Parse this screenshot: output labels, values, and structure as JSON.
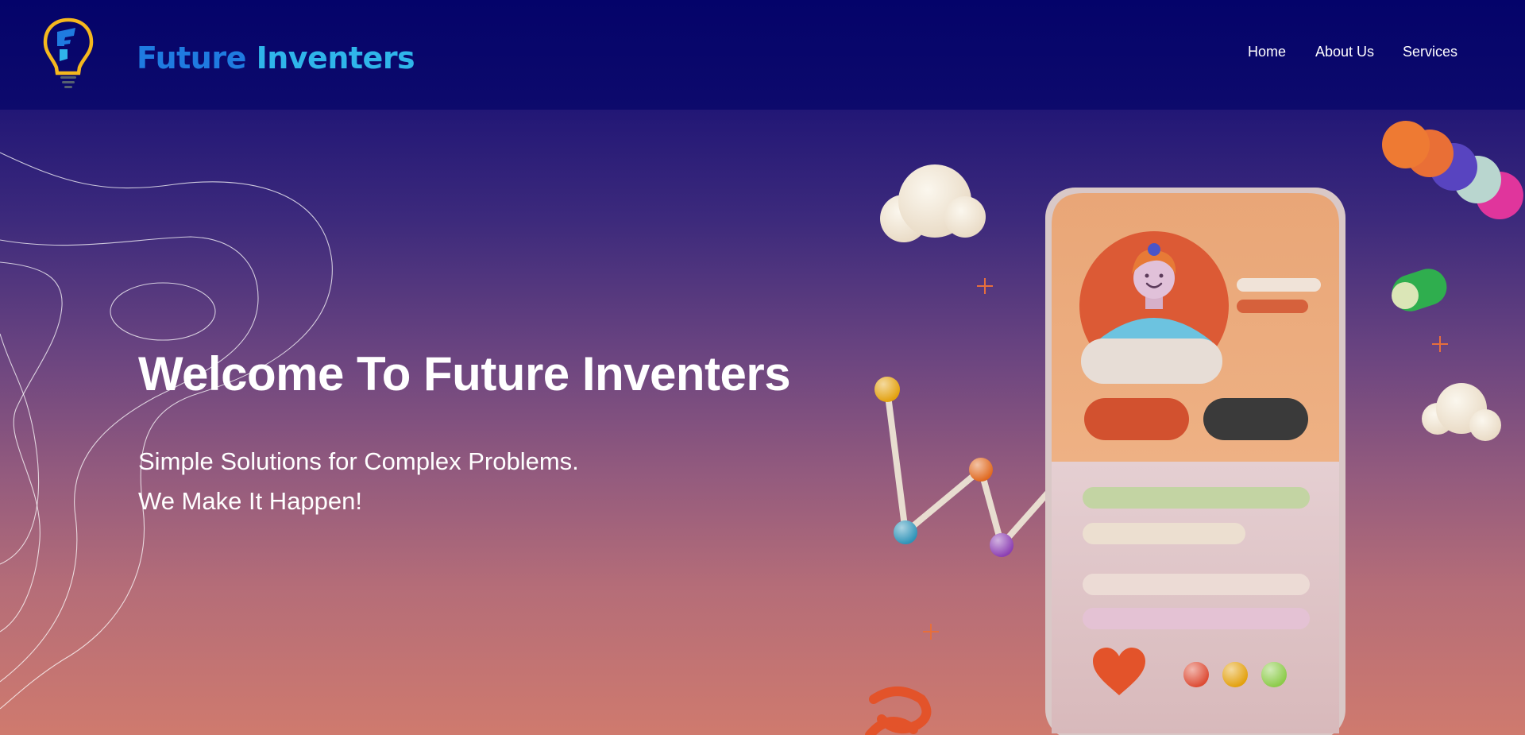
{
  "brand": {
    "name_part1": "Future",
    "name_part2": "Inventers",
    "icon": "lightbulb-icon"
  },
  "nav": {
    "items": [
      {
        "label": "Home"
      },
      {
        "label": "About Us"
      },
      {
        "label": "Services"
      }
    ]
  },
  "hero": {
    "title": "Welcome To Future Inventers",
    "subtitle_line1": "Simple Solutions for Complex Problems.",
    "subtitle_line2": "We Make It Happen!"
  },
  "colors": {
    "header_bg": "#04036a",
    "logo_primary": "#1f7be0",
    "logo_secondary": "#2fb5ea",
    "bulb_outline": "#f5b81e",
    "gradient_top": "#221776",
    "gradient_bottom": "#cf7a6e"
  }
}
